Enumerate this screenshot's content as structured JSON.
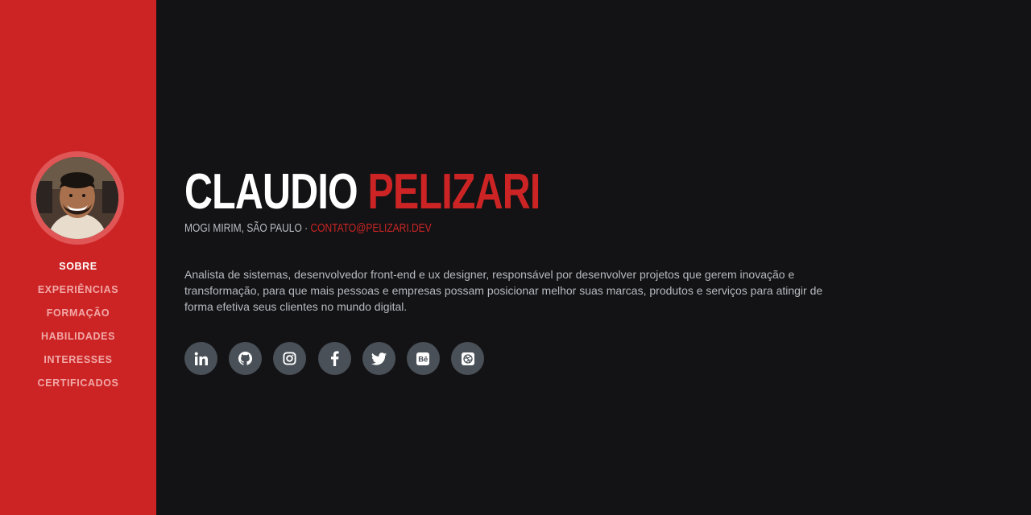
{
  "profile": {
    "first_name": "CLAUDIO",
    "last_name": "PELIZARI",
    "location": "MOGI MIRIM, SÃO PAULO",
    "separator": "·",
    "email": "CONTATO@PELIZARI.DEV",
    "bio": "Analista de sistemas, desenvolvedor front-end e ux designer, responsável por desenvolver projetos que gerem inovação e transformação, para que mais pessoas e empresas possam posicionar melhor suas marcas, produtos e serviços para atingir de forma efetiva seus clientes no mundo digital."
  },
  "nav": {
    "items": [
      {
        "label": "SOBRE",
        "active": true
      },
      {
        "label": "EXPERIÊNCIAS"
      },
      {
        "label": "FORMAÇÃO"
      },
      {
        "label": "HABILIDADES"
      },
      {
        "label": "INTERESSES"
      },
      {
        "label": "CERTIFICADOS"
      }
    ]
  },
  "socials": [
    {
      "icon": "linkedin-icon"
    },
    {
      "icon": "github-icon"
    },
    {
      "icon": "instagram-icon"
    },
    {
      "icon": "facebook-icon"
    },
    {
      "icon": "twitter-icon"
    },
    {
      "icon": "behance-icon"
    },
    {
      "icon": "dribbble-icon"
    }
  ],
  "colors": {
    "sidebar": "#cc2424",
    "background": "#131315",
    "accent": "#cc2424",
    "social_bg": "#495057"
  }
}
